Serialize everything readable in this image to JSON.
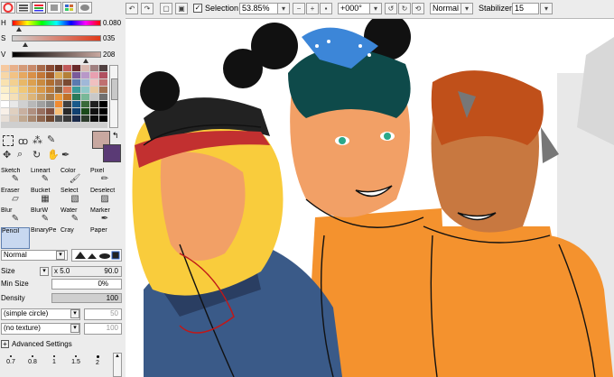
{
  "colors": {
    "accent_orange": "#f4922e",
    "fg_swatch": "#c8a8a0",
    "bg_swatch": "#5a3a75"
  },
  "sliders": [
    {
      "label": "H",
      "value": "0.080"
    },
    {
      "label": "S",
      "value": "035"
    },
    {
      "label": "V",
      "value": "208"
    }
  ],
  "top_toolbar": {
    "selection_label": "Selection",
    "zoom_value": "53.85%",
    "rotation_value": "+000°",
    "blend_mode": "Normal",
    "stabilizer_label": "Stabilizer",
    "stabilizer_value": "15"
  },
  "tools_row1": [
    "Sketch",
    "Lineart",
    "Color",
    "Pixel"
  ],
  "tools_row2": [
    "Eraser",
    "Bucket",
    "Select",
    "Deselect"
  ],
  "tools_row3": [
    "Blur",
    "BlurW",
    "Water",
    "Marker"
  ],
  "tools_row4": [
    "Pencil",
    "BinaryPe",
    "Cray",
    "Paper"
  ],
  "brush_settings": {
    "mode": "Normal",
    "size_label": "Size",
    "size_multiplier": "x 5.0",
    "size_value": "90.0",
    "min_size_label": "Min Size",
    "min_size_value": "0%",
    "density_label": "Density",
    "density_value": "100",
    "shape": "(simple circle)",
    "shape_value": "50",
    "texture": "(no texture)",
    "texture_value": "100",
    "advanced_label": "Advanced Settings"
  },
  "brush_sizes": [
    "0.7",
    "0.8",
    "1",
    "1.5",
    "2"
  ]
}
